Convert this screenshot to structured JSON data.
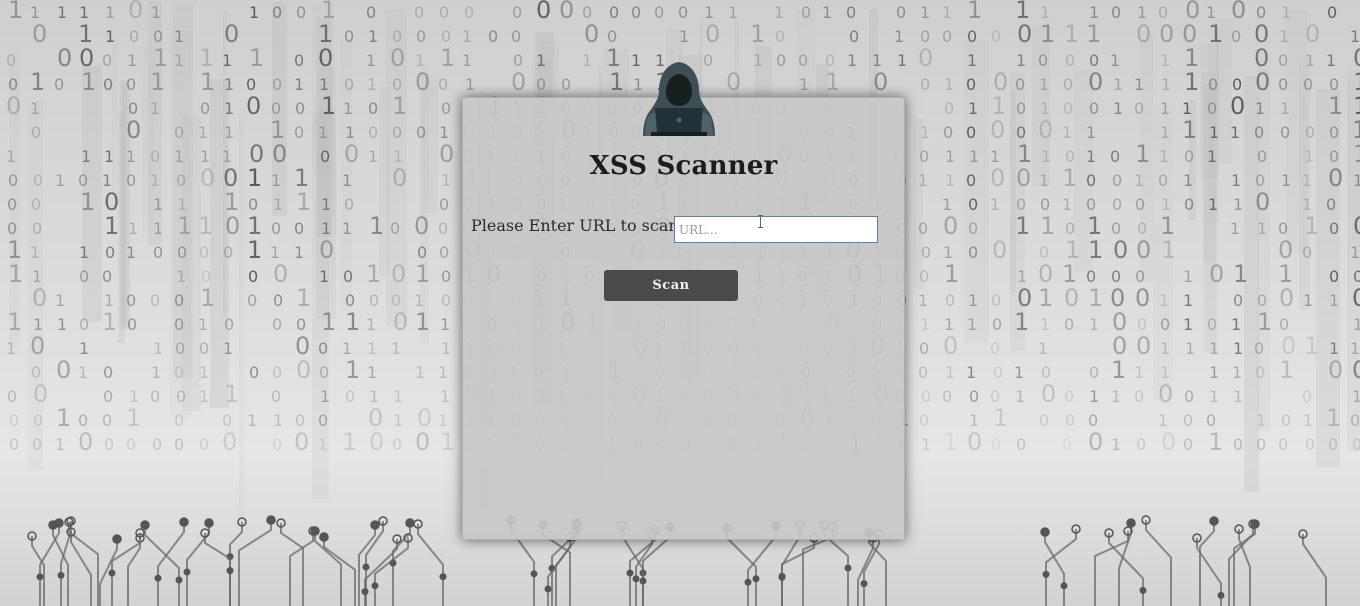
{
  "page": {
    "title": "XSS Scanner"
  },
  "form": {
    "label": "Please Enter URL to scan:",
    "input_value": "",
    "input_placeholder": "URL...",
    "scan_label": "Scan"
  },
  "icons": {
    "logo": "hooded-hacker-laptop-icon",
    "cursor": "text-cursor-icon"
  },
  "colors": {
    "button_bg": "#4a4a4a",
    "card_bg": "#c8c8c8",
    "input_border": "#5b7fb0",
    "title_text": "#1c1c1c"
  }
}
